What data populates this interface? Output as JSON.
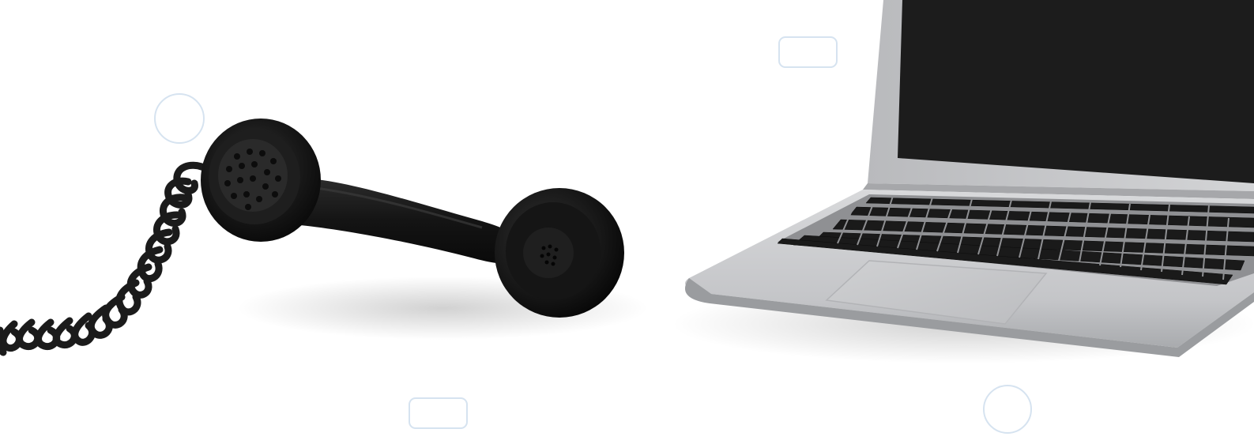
{
  "scene": {
    "background_color": "#ffffff",
    "decoration_color": "#d6e3f0",
    "objects": [
      {
        "name": "telephone-handset",
        "color": "#161616"
      },
      {
        "name": "coiled-phone-cord",
        "color": "#1b1b1b"
      },
      {
        "name": "laptop",
        "color": "#c9cacc",
        "screen_color": "#1c1c1c"
      }
    ]
  }
}
